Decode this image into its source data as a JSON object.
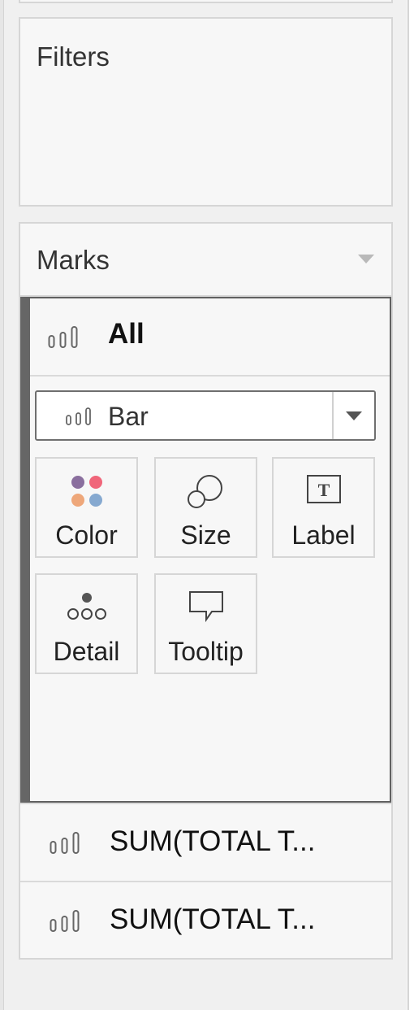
{
  "filters": {
    "title": "Filters"
  },
  "marks": {
    "title": "Marks",
    "all_label": "All",
    "mark_type": "Bar",
    "buttons": [
      {
        "label": "Color",
        "icon": "color-dots-icon"
      },
      {
        "label": "Size",
        "icon": "size-circles-icon"
      },
      {
        "label": "Label",
        "icon": "text-label-icon"
      },
      {
        "label": "Detail",
        "icon": "detail-dots-icon"
      },
      {
        "label": "Tooltip",
        "icon": "tooltip-bubble-icon"
      }
    ],
    "measures": [
      {
        "label": "SUM(TOTAL T..."
      },
      {
        "label": "SUM(TOTAL T..."
      }
    ]
  },
  "colors": {
    "color_dot_purple": "#8a6f9e",
    "color_dot_red": "#f0667a",
    "color_dot_orange": "#eea77a",
    "color_dot_blue": "#86a9d0",
    "active_panel_border": "#666666"
  }
}
